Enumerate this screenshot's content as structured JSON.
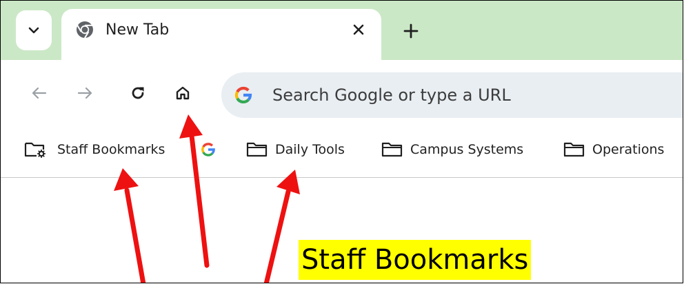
{
  "tabs": [
    {
      "title": "New Tab",
      "icon": "chrome-icon"
    }
  ],
  "toolbar": {
    "back_icon": "arrow-left-icon",
    "forward_icon": "arrow-right-icon",
    "reload_icon": "reload-icon",
    "home_icon": "home-icon"
  },
  "omnibox": {
    "placeholder": "Search Google or type a URL",
    "icon": "google-g-icon"
  },
  "bookmarks": {
    "items": [
      {
        "label": "Staff Bookmarks",
        "icon": "managed-folder-icon"
      },
      {
        "label": "",
        "icon": "google-g-icon"
      },
      {
        "label": "Daily Tools",
        "icon": "folder-icon"
      },
      {
        "label": "Campus Systems",
        "icon": "folder-icon"
      },
      {
        "label": "Operations",
        "icon": "folder-icon"
      }
    ]
  },
  "annotation": {
    "caption": "Staff Bookmarks",
    "arrow_color": "#ee1111",
    "highlight_color": "#ffff00"
  },
  "colors": {
    "tabstrip_bg": "#cbe8c6",
    "omnibox_bg": "#e9eef2"
  }
}
